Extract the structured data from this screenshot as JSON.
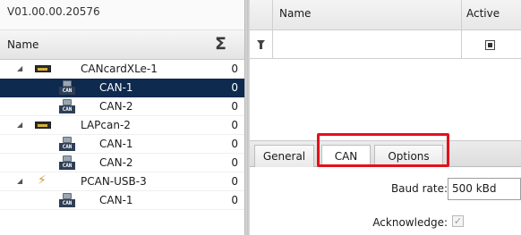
{
  "left_panel": {
    "version": "V01.00.00.20576",
    "header": {
      "name_label": "Name",
      "sum_label": "Σ"
    },
    "rows": [
      {
        "type": "device",
        "label": "CANcardXLe-1",
        "count": "0"
      },
      {
        "type": "channel",
        "label": "CAN-1",
        "count": "0",
        "selected": true
      },
      {
        "type": "channel",
        "label": "CAN-2",
        "count": "0"
      },
      {
        "type": "device",
        "label": "LAPcan-2",
        "count": "0"
      },
      {
        "type": "channel",
        "label": "CAN-1",
        "count": "0"
      },
      {
        "type": "channel",
        "label": "CAN-2",
        "count": "0"
      },
      {
        "type": "usb-device",
        "label": "PCAN-USB-3",
        "count": "0"
      },
      {
        "type": "channel",
        "label": "CAN-1",
        "count": "0"
      }
    ]
  },
  "grid": {
    "columns": {
      "name": "Name",
      "active": "Active"
    }
  },
  "tabs": [
    {
      "label": "General"
    },
    {
      "label": "CAN",
      "active": true
    },
    {
      "label": "Options"
    }
  ],
  "properties": {
    "baud_rate_label": "Baud rate:",
    "baud_rate_value": "500 kBd",
    "acknowledge_label": "Acknowledge:",
    "acknowledge_checked": true,
    "acknowledge_mark": "✓"
  },
  "colors": {
    "selection": "#0e2a4f",
    "highlight_box": "#e5101c"
  }
}
